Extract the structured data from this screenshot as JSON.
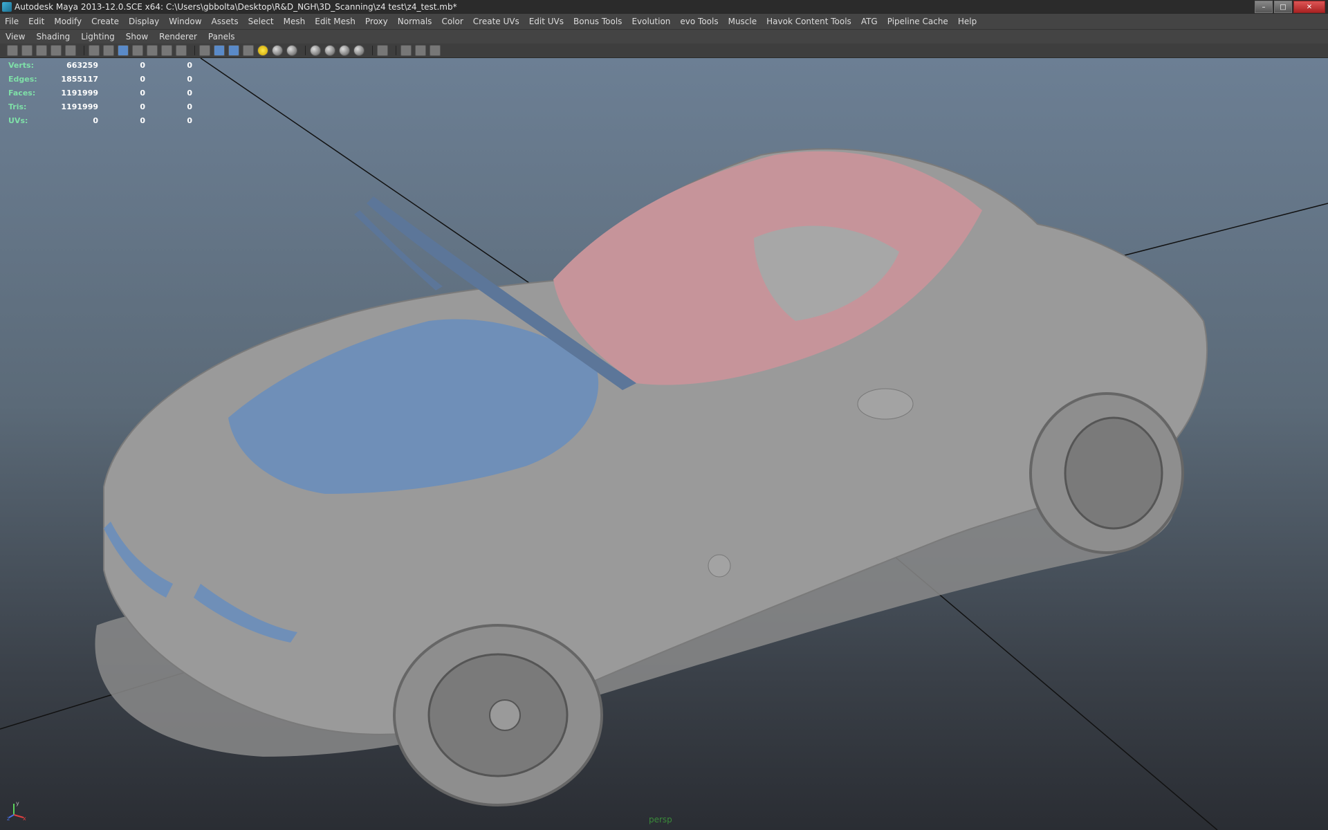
{
  "window": {
    "title": "Autodesk Maya 2013-12.0.SCE x64: C:\\Users\\gbbolta\\Desktop\\R&D_NGH\\3D_Scanning\\z4 test\\z4_test.mb*",
    "controls": {
      "minimize": "–",
      "maximize": "□",
      "close": "✕"
    }
  },
  "menubar": {
    "items": [
      "File",
      "Edit",
      "Modify",
      "Create",
      "Display",
      "Window",
      "Assets",
      "Select",
      "Mesh",
      "Edit Mesh",
      "Proxy",
      "Normals",
      "Color",
      "Create UVs",
      "Edit UVs",
      "Bonus Tools",
      "Evolution",
      "evo Tools",
      "Muscle",
      "Havok Content Tools",
      "ATG",
      "Pipeline Cache",
      "Help"
    ]
  },
  "panel_menu": {
    "items": [
      "View",
      "Shading",
      "Lighting",
      "Show",
      "Renderer",
      "Panels"
    ]
  },
  "hud": {
    "rows": [
      {
        "label": "Verts:",
        "v1": "663259",
        "v2": "0",
        "v3": "0"
      },
      {
        "label": "Edges:",
        "v1": "1855117",
        "v2": "0",
        "v3": "0"
      },
      {
        "label": "Faces:",
        "v1": "1191999",
        "v2": "0",
        "v3": "0"
      },
      {
        "label": "Tris:",
        "v1": "1191999",
        "v2": "0",
        "v3": "0"
      },
      {
        "label": "UVs:",
        "v1": "0",
        "v2": "0",
        "v3": "0"
      }
    ]
  },
  "viewport": {
    "camera_label": "persp",
    "axis": {
      "x": "x",
      "y": "y",
      "z": "z"
    },
    "colors": {
      "mesh_gray": "#9a9a9a",
      "mesh_blue": "#6f8fb8",
      "mesh_pink": "#c6949a"
    }
  }
}
